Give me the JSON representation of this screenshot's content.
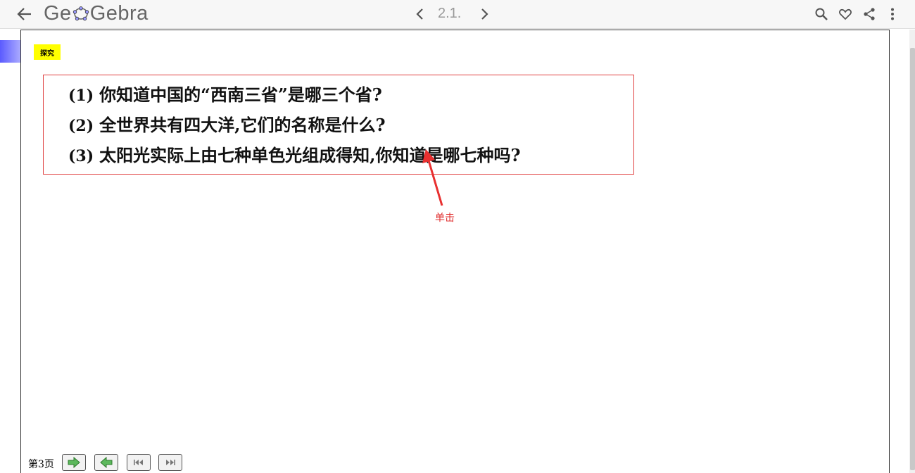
{
  "header": {
    "logo_prefix": "Ge",
    "logo_suffix": "Gebra",
    "nav_label": "2.1.",
    "icons": [
      "back-arrow-icon",
      "chevron-left-icon",
      "chevron-right-icon",
      "search-icon",
      "heart-icon",
      "share-icon",
      "more-vertical-icon"
    ]
  },
  "applet": {
    "badge": "探究",
    "questions": [
      {
        "num": "(1)",
        "text": "你知道中国的“西南三省”是哪三个省?"
      },
      {
        "num": "(2)",
        "text": "全世界共有四大洋,它们的名称是什么?"
      },
      {
        "num": "(3)",
        "text": "太阳光实际上由七种单色光组成得知,你知道是哪七种吗?"
      }
    ],
    "annotation": "单击",
    "page_label": "第3页",
    "controls": [
      "next-page-icon",
      "prev-page-icon",
      "first-page-icon",
      "last-page-icon"
    ]
  },
  "colors": {
    "accent_red": "#e04040",
    "badge_yellow": "#ffff00",
    "ribbon_blue": "#7b7bff",
    "button_green": "#5cb85c"
  }
}
